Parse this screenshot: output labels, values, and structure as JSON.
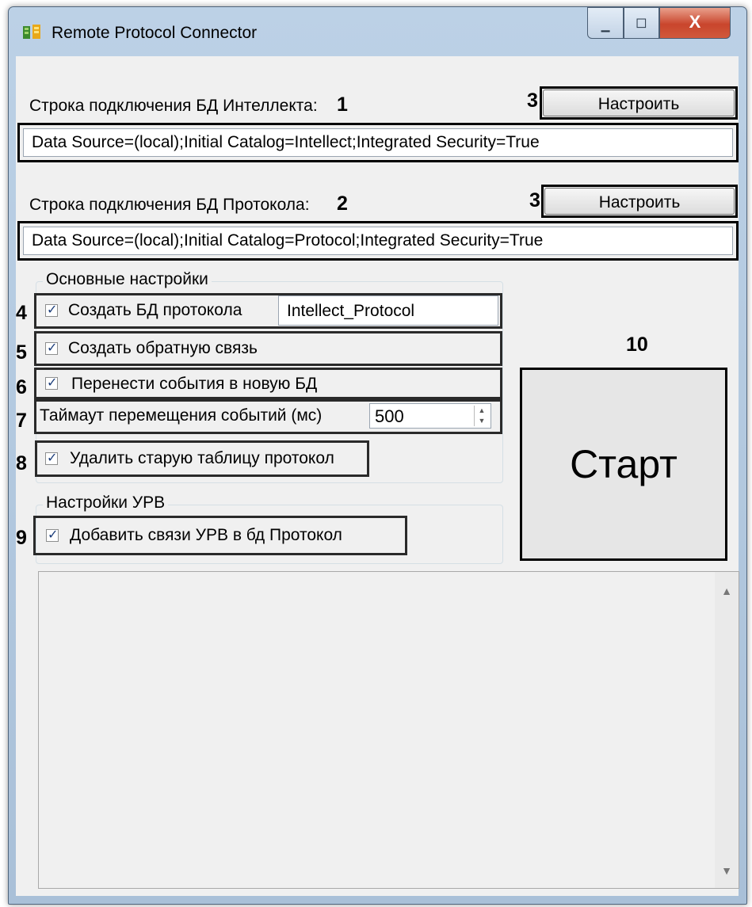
{
  "window": {
    "title": "Remote Protocol Connector",
    "controls": {
      "minimize": "▁",
      "maximize": "◻",
      "close": "X"
    }
  },
  "intellect_db": {
    "label": "Строка подключения БД Интеллекта:",
    "marker": "1",
    "connection_string": "Data Source=(local);Initial Catalog=Intellect;Integrated Security=True",
    "button_marker": "3",
    "button_label": "Настроить"
  },
  "protocol_db": {
    "label": "Строка подключения БД Протокола:",
    "marker": "2",
    "connection_string": "Data Source=(local);Initial Catalog=Protocol;Integrated Security=True",
    "button_marker": "3",
    "button_label": "Настроить"
  },
  "main_settings": {
    "title": "Основные настройки",
    "create_db": {
      "marker": "4",
      "label": "Создать БД протокола",
      "checked": true,
      "db_name": "Intellect_Protocol"
    },
    "create_feedback": {
      "marker": "5",
      "label": "Создать обратную связь",
      "checked": true
    },
    "move_events": {
      "marker": "6",
      "label": "Перенести события в новую БД",
      "checked": true
    },
    "timeout": {
      "marker": "7",
      "label": "Таймаут перемещения событий (мс)",
      "value": "500"
    },
    "delete_table": {
      "marker": "8",
      "label": "Удалить старую таблицу протокол",
      "checked": true
    }
  },
  "urv_settings": {
    "title": "Настройки УРВ",
    "add_links": {
      "marker": "9",
      "label": "Добавить связи УРВ в бд Протокол",
      "checked": true
    }
  },
  "start": {
    "marker": "10",
    "label": "Старт"
  }
}
